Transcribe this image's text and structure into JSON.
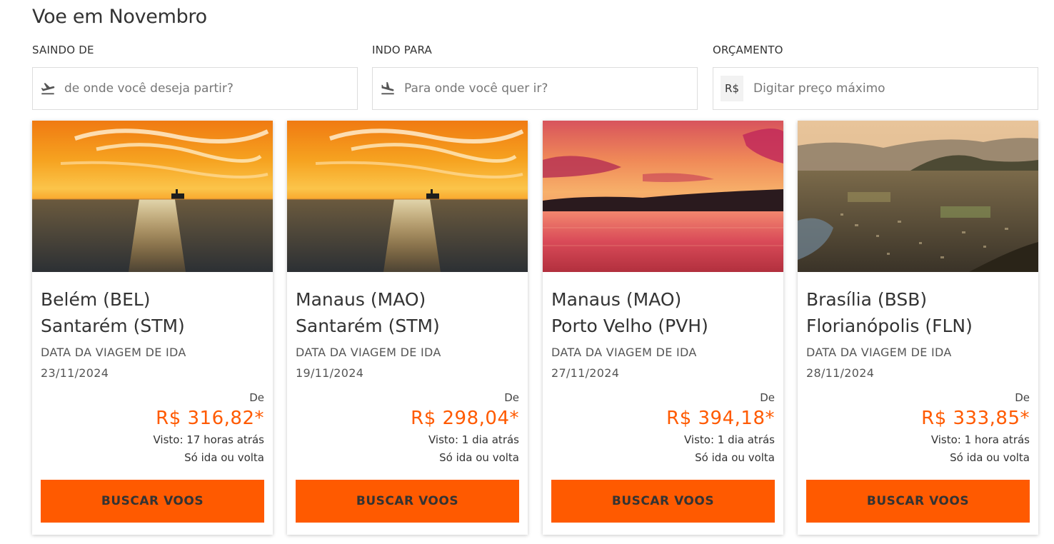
{
  "page": {
    "title": "Voe em Novembro"
  },
  "filters": {
    "from": {
      "label": "SAINDO DE",
      "placeholder": "de onde você deseja partir?",
      "icon": "plane-takeoff-icon"
    },
    "to": {
      "label": "INDO PARA",
      "placeholder": "Para onde você quer ir?",
      "icon": "plane-landing-icon"
    },
    "budget": {
      "label": "ORÇAMENTO",
      "currency": "R$",
      "placeholder": "Digitar preço máximo"
    }
  },
  "cards": [
    {
      "origin": "Belém (BEL)",
      "destination": "Santarém (STM)",
      "date_label": "DATA DA VIAGEM DE IDA",
      "date": "23/11/2024",
      "from_label": "De",
      "price": "R$ 316,82*",
      "seen": "Visto: 17 horas atrás",
      "trip_type": "Só ida ou volta",
      "button": "BUSCAR VOOS",
      "image": "sunset-ship-sea"
    },
    {
      "origin": "Manaus (MAO)",
      "destination": "Santarém (STM)",
      "date_label": "DATA DA VIAGEM DE IDA",
      "date": "19/11/2024",
      "from_label": "De",
      "price": "R$ 298,04*",
      "seen": "Visto: 1 dia atrás",
      "trip_type": "Só ida ou volta",
      "button": "BUSCAR VOOS",
      "image": "sunset-ship-sea"
    },
    {
      "origin": "Manaus (MAO)",
      "destination": "Porto Velho (PVH)",
      "date_label": "DATA DA VIAGEM DE IDA",
      "date": "27/11/2024",
      "from_label": "De",
      "price": "R$ 394,18*",
      "seen": "Visto: 1 dia atrás",
      "trip_type": "Só ida ou volta",
      "button": "BUSCAR VOOS",
      "image": "red-sunset-river"
    },
    {
      "origin": "Brasília (BSB)",
      "destination": "Florianópolis (FLN)",
      "date_label": "DATA DA VIAGEM DE IDA",
      "date": "28/11/2024",
      "from_label": "De",
      "price": "R$ 333,85*",
      "seen": "Visto: 1 hora atrás",
      "trip_type": "Só ida ou volta",
      "button": "BUSCAR VOOS",
      "image": "city-aerial-view"
    }
  ],
  "colors": {
    "accent": "#ff5a00",
    "text": "#333333",
    "border": "#dddddd"
  }
}
